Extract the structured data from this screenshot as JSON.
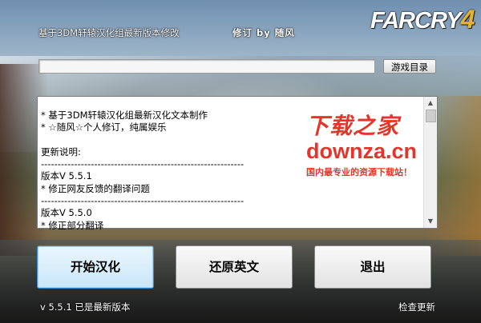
{
  "header": {
    "title": "基于3DM轩辕汉化组最新版本修改",
    "revise": "修订 by 随风",
    "logo_main": "FARCRY",
    "logo_num": "4"
  },
  "path": {
    "value": "",
    "dir_button": "游戏目录"
  },
  "log": {
    "lines": [
      "* 基于3DM轩辕汉化组最新汉化文本制作",
      "* ☆随风☆个人修订，纯属娱乐",
      "",
      "更新说明:",
      "-------------------------------------------------------------",
      "版本V 5.5.1",
      "* 修正网友反馈的翻译问题",
      "-------------------------------------------------------------",
      "版本V 5.5.0",
      "* 修正部分翻译"
    ]
  },
  "watermark": {
    "cn": "下载之家",
    "en": "downza.cn",
    "sub": "国内最专业的资源下载站！"
  },
  "buttons": {
    "start": "开始汉化",
    "restore": "还原英文",
    "exit": "退出"
  },
  "footer": {
    "version": "v 5.5.1  已是最新版本",
    "check_update": "检查更新"
  },
  "colors": {
    "accent": "#3c8ccc",
    "watermark": "#e5342a",
    "logo_num": "#e5b52b"
  }
}
